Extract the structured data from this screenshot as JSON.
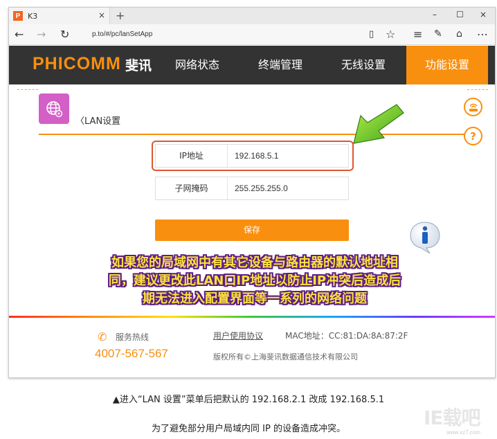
{
  "browser": {
    "tab_title": "K3",
    "favicon_letter": "P",
    "tab_close": "×",
    "new_tab": "+",
    "url": "p.to/#/pc/lanSetApp",
    "win_min": "–",
    "win_max": "☐",
    "win_close": "×"
  },
  "header": {
    "logo": "PHICOMM",
    "logo_cn": "斐讯",
    "nav": [
      "网络状态",
      "终端管理",
      "无线设置",
      "功能设置"
    ]
  },
  "page": {
    "title": "LAN设置",
    "back_glyph": "〈",
    "help_glyph": "?"
  },
  "form": {
    "ip_label": "IP地址",
    "ip_value": "192.168.5.1",
    "mask_label": "子网掩码",
    "mask_value": "255.255.255.0",
    "save_label": "保存"
  },
  "overlay": {
    "line1": "如果您的局域网中有其它设备与路由器的默认地址相",
    "line2": "同，建议更改此LAN口IP地址以防止IP冲突后造成后",
    "line3": "期无法进入配置界面等一系列的网络问题"
  },
  "footer": {
    "hotline_label": "服务热线",
    "hotline_number": "4007-567-567",
    "agreement": "用户使用协议",
    "mac": "MAC地址：CC:81:DA:8A:87:2F",
    "copyright": "版权所有©上海斐讯数据通信技术有限公司"
  },
  "captions": {
    "line1": "▲进入“LAN 设置”菜单后把默认的 192.168.2.1 改成 192.168.5.1",
    "line2": "为了避免部分用户局域内同 IP 的设备造成冲突。"
  },
  "watermark": {
    "logo": "IE载吧",
    "url": "www.xz7.com"
  },
  "colors": {
    "brand_orange": "#f98f0e",
    "header_bg": "#333333",
    "highlight_red": "#e05533",
    "overlay_yellow": "#ffe23c"
  }
}
